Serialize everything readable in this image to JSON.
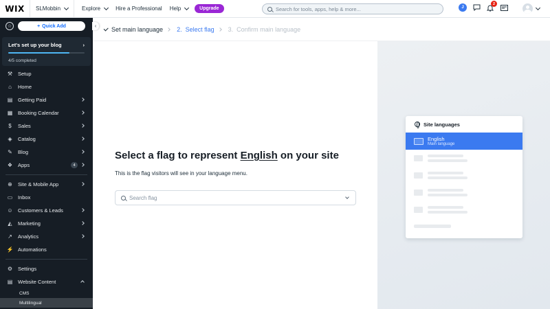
{
  "topbar": {
    "logo": "WIX",
    "site_name": "SLMobbin",
    "nav": [
      "Explore",
      "Hire a Professional",
      "Help"
    ],
    "upgrade": "Upgrade",
    "search_placeholder": "Search for tools, apps, help & more...",
    "avatar_initial": "J",
    "notifications_count": "2"
  },
  "sidebar": {
    "quick_add": "Quick Add",
    "setup": {
      "title": "Let's set up your blog",
      "progress_text": "4/5 completed",
      "progress": 0.8
    },
    "items": [
      {
        "label": "Setup",
        "icon": "setup-icon"
      },
      {
        "label": "Home",
        "icon": "home-icon"
      },
      {
        "label": "Getting Paid",
        "icon": "dollar-icon"
      },
      {
        "label": "Booking Calendar",
        "icon": "calendar-icon"
      },
      {
        "label": "Sales",
        "icon": "sales-icon"
      },
      {
        "label": "Catalog",
        "icon": "catalog-icon"
      },
      {
        "label": "Blog",
        "icon": "blog-icon"
      },
      {
        "label": "Apps",
        "icon": "apps-icon",
        "count": "4"
      },
      {
        "label": "Site & Mobile App",
        "icon": "globe-icon"
      },
      {
        "label": "Inbox",
        "icon": "inbox-icon"
      },
      {
        "label": "Customers & Leads",
        "icon": "people-icon"
      },
      {
        "label": "Marketing",
        "icon": "megaphone-icon"
      },
      {
        "label": "Analytics",
        "icon": "analytics-icon"
      },
      {
        "label": "Automations",
        "icon": "automations-icon"
      },
      {
        "label": "Settings",
        "icon": "settings-icon"
      },
      {
        "label": "Website Content",
        "icon": "content-icon"
      }
    ],
    "subitems": [
      "CMS",
      "Multilingual"
    ]
  },
  "breadcrumb": {
    "steps": [
      "Set main language",
      "Select flag",
      "Confirm main language"
    ]
  },
  "main": {
    "heading_pre": "Select a flag to represent ",
    "heading_lang": "English",
    "heading_post": " on your site",
    "subtext": "This is the flag visitors will see in your language menu.",
    "search_placeholder": "Search flag"
  },
  "preview": {
    "title": "Site languages",
    "selected_name": "English",
    "selected_sub": "Main language"
  },
  "colors": {
    "accent": "#3b7af0",
    "sidebar_bg": "#161d25",
    "upgrade": "#9a27d5"
  }
}
